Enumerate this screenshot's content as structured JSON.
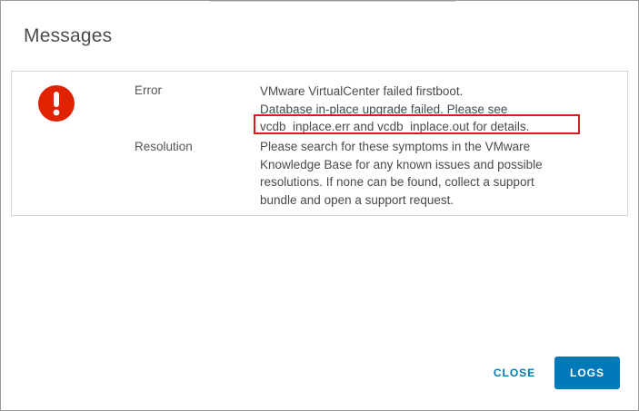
{
  "dialog": {
    "title": "Messages",
    "message": {
      "icon": "error-exclamation-icon",
      "icon_color": "#e12200",
      "error_label": "Error",
      "error_lines": [
        "VMware VirtualCenter failed firstboot.",
        "Database in-place upgrade failed. Please see",
        "vcdb_inplace.err and vcdb_inplace.out for details."
      ],
      "resolution_label": "Resolution",
      "resolution_lines": [
        "Please search for these symptoms in the VMware",
        "Knowledge Base for any known issues and possible",
        "resolutions. If none can be found, collect a support",
        "bundle and open a support request."
      ],
      "highlight_color": "#d81b1b"
    },
    "buttons": {
      "close_label": "CLOSE",
      "logs_label": "LOGS"
    },
    "accent_color": "#0079b8"
  }
}
